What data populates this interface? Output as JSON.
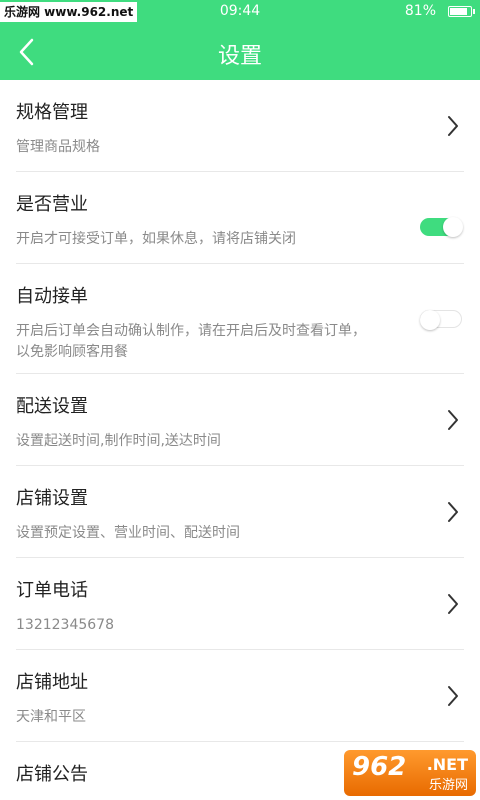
{
  "status_bar": {
    "watermark": "乐游网 www.962.net",
    "time": "09:44",
    "battery": "81%",
    "battery_level": 0.81
  },
  "header": {
    "title": "设置",
    "back_icon": "chevron-left-icon",
    "background": "#3fdc7f"
  },
  "settings": [
    {
      "title": "规格管理",
      "subtitle": "管理商品规格",
      "control": "chevron"
    },
    {
      "title": "是否营业",
      "subtitle": "开启才可接受订单，如果休息，请将店铺关闭",
      "control": "toggle",
      "enabled": true
    },
    {
      "title": "自动接单",
      "subtitle_line1": "开启后订单会自动确认制作，请在开启后及时查看订单，",
      "subtitle_line2": "以免影响顾客用餐",
      "control": "toggle",
      "enabled": false
    },
    {
      "title": "配送设置",
      "subtitle": "设置起送时间,制作时间,送达时间",
      "control": "chevron"
    },
    {
      "title": "店铺设置",
      "subtitle": "设置预定设置、营业时间、配送时间",
      "control": "chevron"
    },
    {
      "title": "订单电话",
      "subtitle": "13212345678",
      "control": "chevron"
    },
    {
      "title": "店铺地址",
      "subtitle": "天津和平区",
      "control": "chevron"
    },
    {
      "title": "店铺公告",
      "control": "chevron"
    }
  ],
  "watermark_bottom": {
    "big": "962",
    "net": ".NET",
    "cn": "乐游网"
  }
}
